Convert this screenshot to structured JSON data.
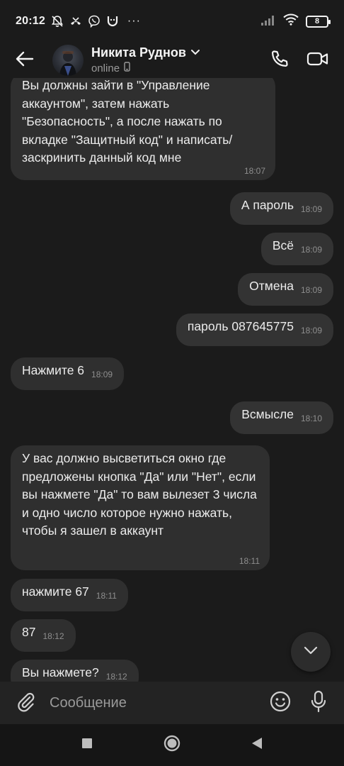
{
  "status_bar": {
    "time": "20:12",
    "more": "···",
    "battery_level": "8"
  },
  "header": {
    "contact_name": "Никита Руднов",
    "presence": "online"
  },
  "messages": [
    {
      "dir": "in",
      "text": "Вы должны зайти в \"Управление аккаунтом\", затем нажать \"Безопасность\", а после нажать по вкладке \"Защитный код\" и написать/ заскринить данный код мне",
      "time": "18:07"
    },
    {
      "dir": "out",
      "text": "А пароль",
      "time": "18:09"
    },
    {
      "dir": "out",
      "text": "Всё",
      "time": "18:09"
    },
    {
      "dir": "out",
      "text": "Отмена",
      "time": "18:09"
    },
    {
      "dir": "out",
      "text": "пароль 087645775",
      "time": "18:09"
    },
    {
      "dir": "in",
      "text": "Нажмите 6",
      "time": "18:09"
    },
    {
      "dir": "out",
      "text": "Всмысле",
      "time": "18:10"
    },
    {
      "dir": "in",
      "text": "У вас должно высветиться окно где предложены кнопка \"Да\" или \"Нет\", если вы нажмете \"Да\" то вам вылезет 3 числа и одно число которое нужно нажать, чтобы я зашел в аккаунт",
      "time": "18:11"
    },
    {
      "dir": "in",
      "text": "нажмите 67",
      "time": "18:11"
    },
    {
      "dir": "in",
      "text": "87",
      "time": "18:12"
    },
    {
      "dir": "in",
      "text": "Вы нажмете?",
      "time": "18:12"
    }
  ],
  "composer": {
    "placeholder": "Сообщение"
  },
  "colors": {
    "background": "#1b1b1b",
    "bubble": "#2f2f2f",
    "composer": "#232323",
    "timestamp": "#8e8e8e"
  },
  "icons": [
    "mute-icon",
    "missed-call-icon",
    "viber-icon",
    "smile-app-icon",
    "signal-icon",
    "wifi-icon",
    "battery-icon",
    "back-arrow-icon",
    "chevron-down-icon",
    "phone-icon",
    "video-camera-icon",
    "attach-icon",
    "emoji-icon",
    "microphone-icon",
    "nav-square-icon",
    "nav-circle-icon",
    "nav-triangle-icon"
  ]
}
